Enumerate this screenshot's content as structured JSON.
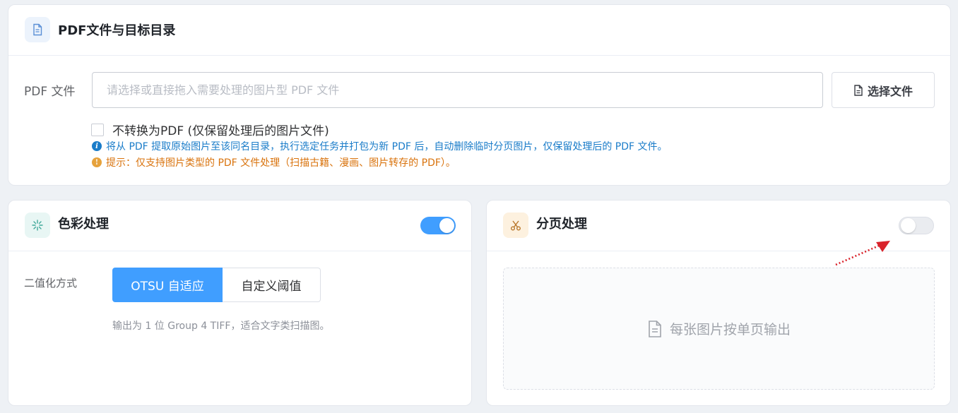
{
  "pdf_section": {
    "title": "PDF文件与目标目录",
    "file_label": "PDF 文件",
    "file_input": {
      "value": "",
      "placeholder": "请选择或直接拖入需要处理的图片型 PDF 文件"
    },
    "choose_button": "选择文件",
    "no_convert": {
      "checked": false,
      "label": "不转换为PDF (仅保留处理后的图片文件)"
    },
    "info_note": "将从 PDF 提取原始图片至该同名目录，执行选定任务并打包为新 PDF 后，自动删除临时分页图片，仅保留处理后的 PDF 文件。",
    "warn_note": "提示：仅支持图片类型的 PDF 文件处理（扫描古籍、漫画、图片转存的 PDF）。"
  },
  "color_section": {
    "title": "色彩处理",
    "enabled": true,
    "binarize_label": "二值化方式",
    "options": [
      "OTSU 自适应",
      "自定义阈值"
    ],
    "selected": "OTSU 自适应",
    "description": "输出为 1 位 Group 4 TIFF，适合文字类扫描图。"
  },
  "split_section": {
    "title": "分页处理",
    "enabled": false,
    "empty_text": "每张图片按单页输出"
  },
  "colors": {
    "accent": "#409eff",
    "info": "#1a7cc9",
    "warning": "#d9730d",
    "annotation_arrow": "#d9232b"
  },
  "icons": {
    "pdf_header": "document-icon",
    "choose_button": "document-icon",
    "color_header": "sparkle-icon",
    "split_header": "scissors-icon",
    "dropzone": "document-icon",
    "info_note": "info-icon",
    "warn_note": "warning-icon"
  }
}
